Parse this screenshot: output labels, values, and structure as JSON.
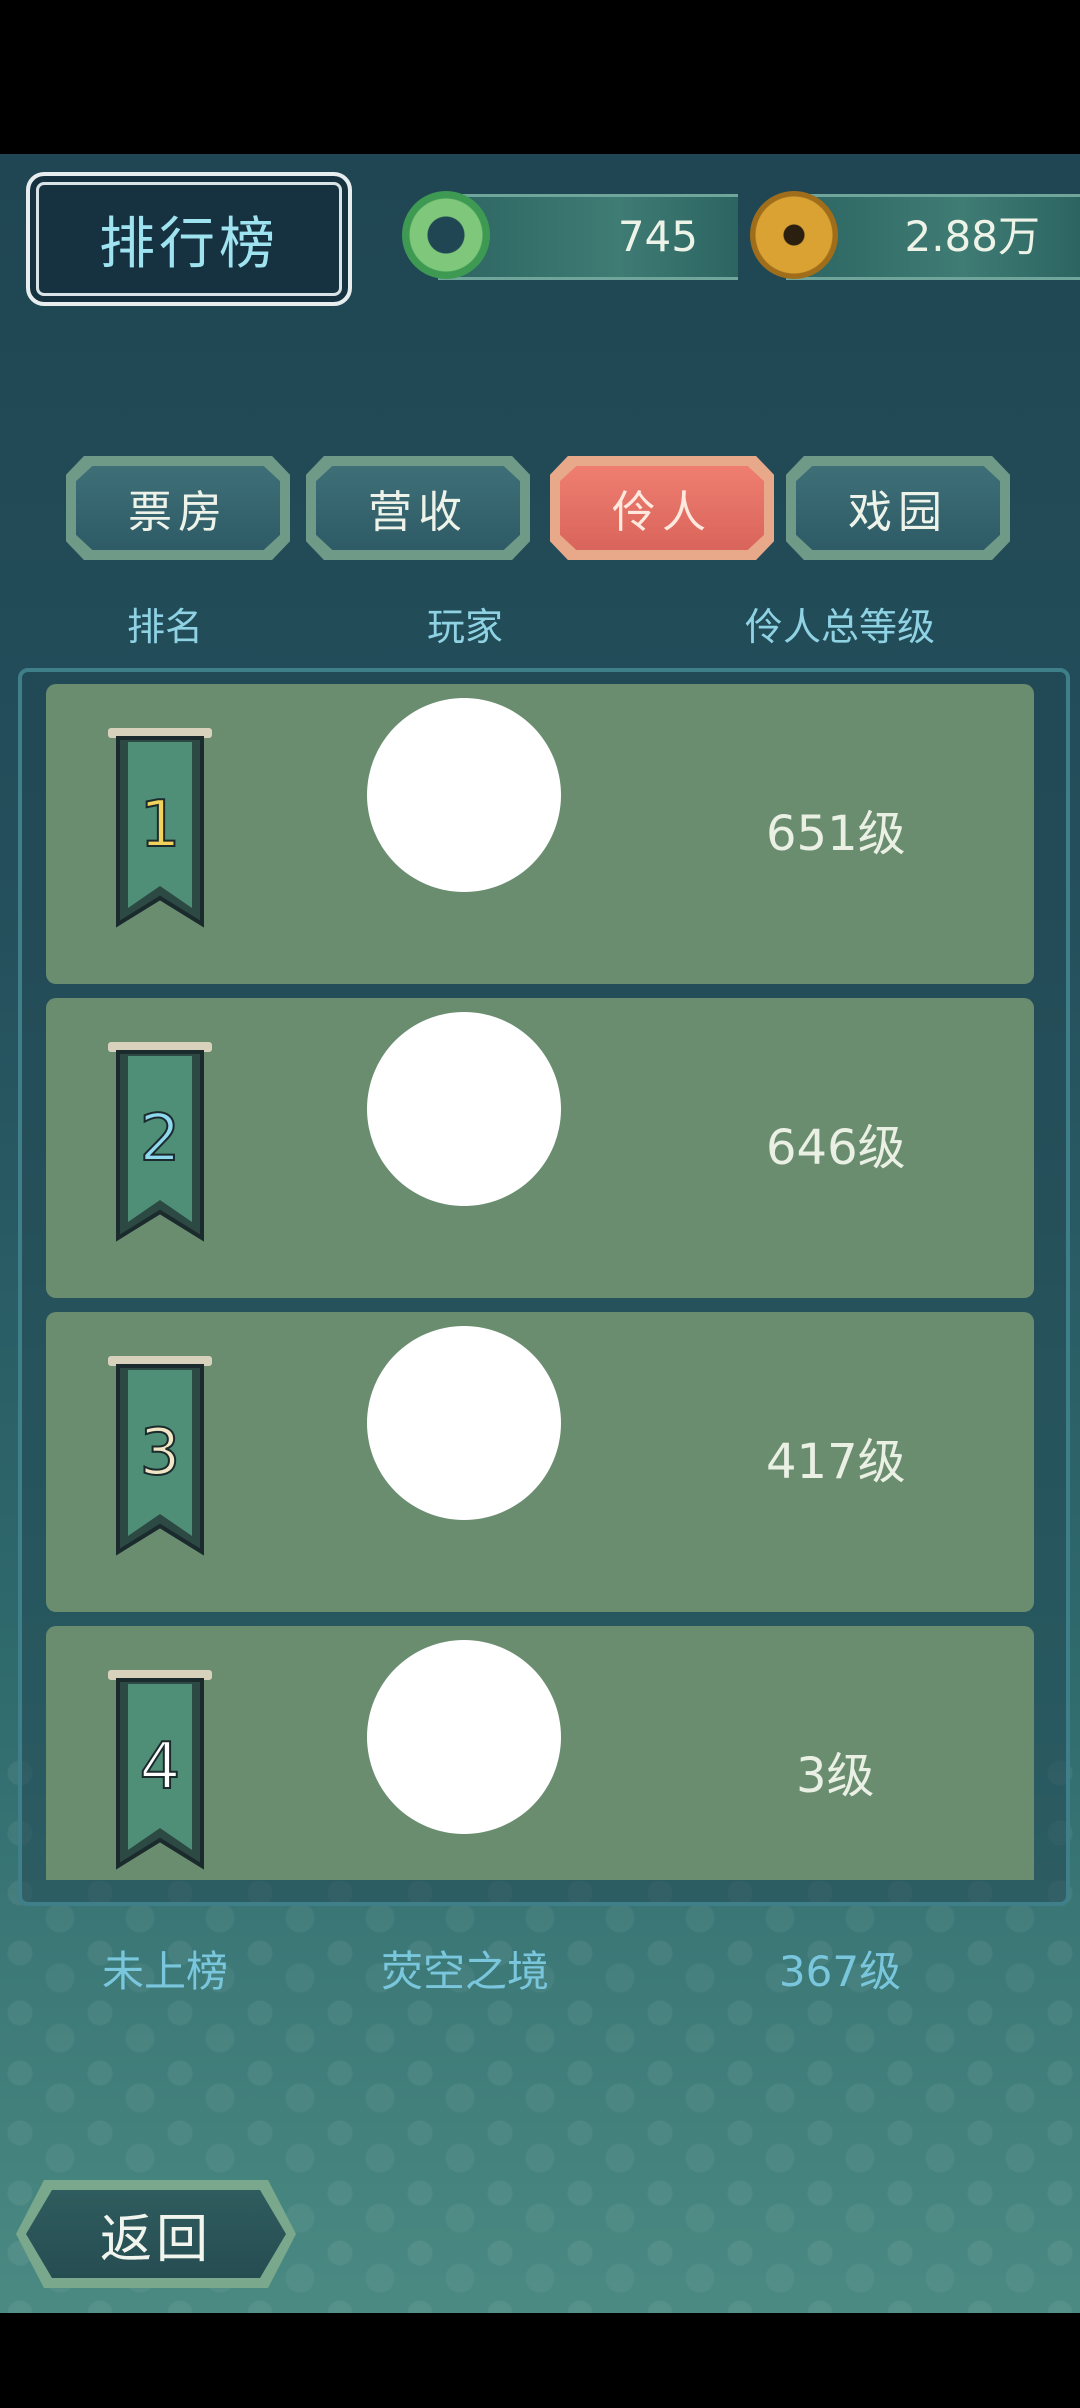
{
  "header": {
    "title": "排行榜",
    "jade_count": "745",
    "coin_count": "2.88万"
  },
  "tabs": [
    {
      "label": "票房",
      "active": false
    },
    {
      "label": "营收",
      "active": false
    },
    {
      "label": "伶人",
      "active": true
    },
    {
      "label": "戏园",
      "active": false
    }
  ],
  "columns": {
    "rank": "排名",
    "player": "玩家",
    "level": "伶人总等级"
  },
  "rows": [
    {
      "rank": "1",
      "level": "651级",
      "rank_color": "#f2d25a"
    },
    {
      "rank": "2",
      "level": "646级",
      "rank_color": "#8fd8ee"
    },
    {
      "rank": "3",
      "level": "417级",
      "rank_color": "#f1e6c6"
    },
    {
      "rank": "4",
      "level": "3级",
      "rank_color": "#ffffff"
    }
  ],
  "self": {
    "rank": "未上榜",
    "name": "荧空之境",
    "level": "367级"
  },
  "back_label": "返回",
  "icons": {
    "jade": "jade-disc-icon",
    "coin": "copper-coin-icon",
    "banner": "rank-banner-icon"
  }
}
